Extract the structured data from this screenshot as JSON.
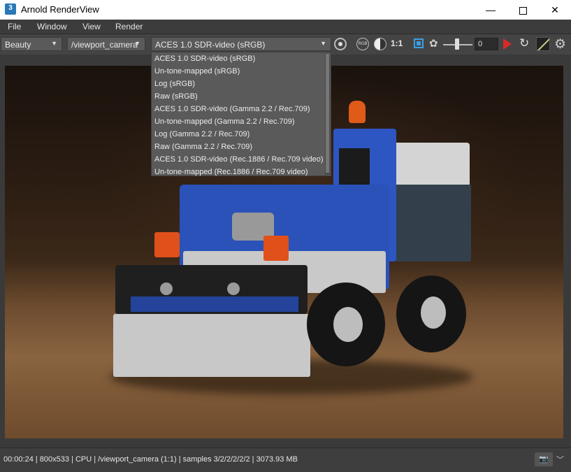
{
  "window": {
    "title": "Arnold RenderView",
    "icon_label": "3",
    "controls": {
      "minimize": "—",
      "close": "✕"
    }
  },
  "menu": [
    "File",
    "Window",
    "View",
    "Render"
  ],
  "toolbar": {
    "aov": "Beauty",
    "camera": "/viewport_camera",
    "view_transform": "ACES 1.0 SDR-video (sRGB)",
    "rgb_label": "RGB",
    "zoom_label": "1:1",
    "exposure_value": "0",
    "icons": [
      "channel-ring-icon",
      "rgb-icon",
      "ab-compare-icon",
      "crop-region-icon",
      "isolate-icon",
      "play-icon",
      "refresh-icon",
      "debug-shading-icon",
      "settings-icon"
    ]
  },
  "dropdown": {
    "items": [
      "ACES 1.0 SDR-video (sRGB)",
      "Un-tone-mapped (sRGB)",
      "Log (sRGB)",
      "Raw (sRGB)",
      "ACES 1.0 SDR-video (Gamma 2.2 / Rec.709)",
      "Un-tone-mapped (Gamma 2.2 / Rec.709)",
      "Log (Gamma 2.2 / Rec.709)",
      "Raw (Gamma 2.2 / Rec.709)",
      "ACES 1.0 SDR-video (Rec.1886 / Rec.709 video)",
      "Un-tone-mapped (Rec.1886 / Rec.709 video)"
    ]
  },
  "status": {
    "text": "00:00:24 |  800x533 | CPU | /viewport_camera (1:1) | samples 3/2/2/2/2/2 | 3073.93 MB"
  },
  "colors": {
    "accent_blue": "#3aa0e8",
    "play_red": "#d62a2a"
  }
}
